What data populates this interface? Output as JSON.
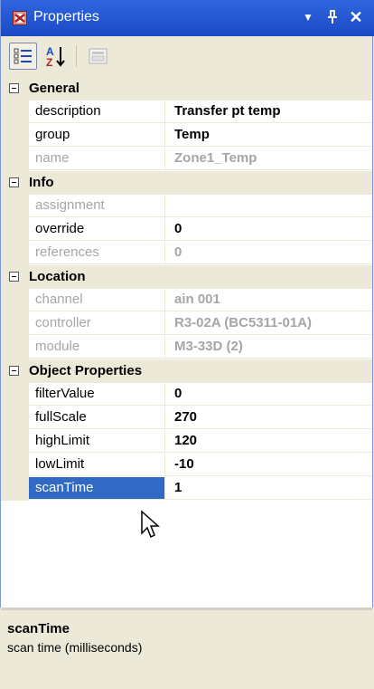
{
  "window": {
    "title": "Properties",
    "dropdown_glyph": "▼",
    "pin_glyph": "ᵖ",
    "close_glyph": "✕"
  },
  "toolbar": {
    "categorized_icon": "categorized-icon",
    "alphabetical_icon": "alphabetical-icon",
    "property_pages_icon": "property-pages-icon"
  },
  "grid": {
    "categories": [
      {
        "name": "General",
        "properties": [
          {
            "name": "description",
            "value": "Transfer pt temp",
            "readonly": false
          },
          {
            "name": "group",
            "value": "Temp",
            "readonly": false
          },
          {
            "name": "name",
            "value": "Zone1_Temp",
            "readonly": true
          }
        ]
      },
      {
        "name": "Info",
        "properties": [
          {
            "name": "assignment",
            "value": "",
            "readonly": true
          },
          {
            "name": "override",
            "value": "0",
            "readonly": false
          },
          {
            "name": "references",
            "value": "0",
            "readonly": true
          }
        ]
      },
      {
        "name": "Location",
        "properties": [
          {
            "name": "channel",
            "value": "ain 001",
            "readonly": true
          },
          {
            "name": "controller",
            "value": "R3-02A (BC5311-01A)",
            "readonly": true
          },
          {
            "name": "module",
            "value": "M3-33D (2)",
            "readonly": true
          }
        ]
      },
      {
        "name": "Object Properties",
        "properties": [
          {
            "name": "filterValue",
            "value": "0",
            "readonly": false
          },
          {
            "name": "fullScale",
            "value": "270",
            "readonly": false
          },
          {
            "name": "highLimit",
            "value": "120",
            "readonly": false
          },
          {
            "name": "lowLimit",
            "value": "-10",
            "readonly": false
          },
          {
            "name": "scanTime",
            "value": "1",
            "readonly": false,
            "selected": true
          }
        ]
      }
    ]
  },
  "description_pane": {
    "title": "scanTime",
    "text": "scan time (milliseconds)"
  },
  "colors": {
    "title_bar": "#2f66e0",
    "selection": "#316ac5",
    "readonly_text": "#a6a6a6",
    "chrome": "#ece9d8"
  }
}
